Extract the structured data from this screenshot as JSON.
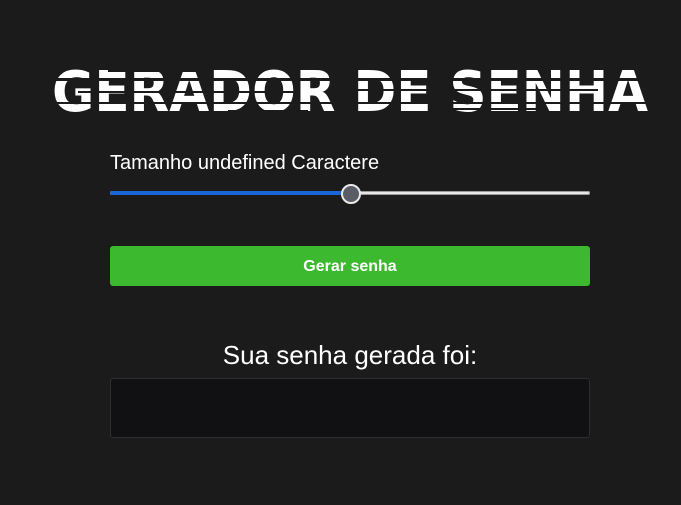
{
  "header": {
    "title": "GERADOR DE SENHA"
  },
  "length_control": {
    "label": "Tamanho undefined Caractere",
    "slider_value_fraction": 0.5
  },
  "actions": {
    "generate_label": "Gerar senha"
  },
  "result": {
    "title": "Sua senha gerada foi:",
    "password": ""
  },
  "colors": {
    "background": "#1b1b1c",
    "button": "#3cb92f",
    "slider_fill": "#1a66d9",
    "password_box": "#111113"
  }
}
